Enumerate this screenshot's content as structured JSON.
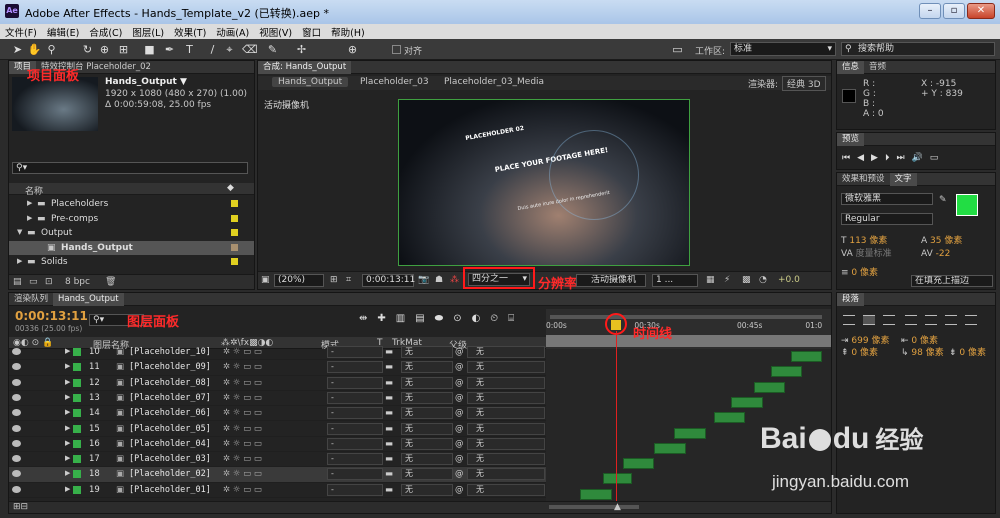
{
  "title": {
    "app": "Adobe After Effects - Hands_Template_v2 (已转换).aep *",
    "logo": "Ae"
  },
  "menu": [
    "文件(F)",
    "编辑(E)",
    "合成(C)",
    "图层(L)",
    "效果(T)",
    "动画(A)",
    "视图(V)",
    "窗口",
    "帮助(H)"
  ],
  "toolbar": {
    "snap_label": "对齐",
    "workspace_label": "工作区:",
    "workspace_value": "标准",
    "search_placeholder": "搜索帮助"
  },
  "project": {
    "tab": "项目",
    "tab2": "特效控制台 Placeholder_02",
    "comp_name": "Hands_Output ▼",
    "resolution": "1920 x 1080  (480 x 270) (1.00)",
    "duration": "Δ 0:00:59:08, 25.00 fps",
    "search_icon": "⚲▾",
    "col_name": "名称",
    "folders": [
      {
        "name": "Placeholders",
        "indent": 1,
        "open": false,
        "color": "#e0d020"
      },
      {
        "name": "Pre-comps",
        "indent": 1,
        "open": false,
        "color": "#e0d020"
      },
      {
        "name": "Output",
        "indent": 0,
        "open": true,
        "color": "#e0d020"
      },
      {
        "name": "Hands_Output",
        "indent": 2,
        "comp": true,
        "color": "#a89070"
      },
      {
        "name": "Solids",
        "indent": 0,
        "open": false,
        "color": "#e0d020"
      }
    ],
    "bpc": "8 bpc",
    "annotation": "项目面板"
  },
  "comp": {
    "tab": "合成: Hands_Output",
    "crumbs": [
      "Hands_Output",
      "Placeholder_03",
      "Placeholder_03_Media"
    ],
    "renderer_label": "渲染器:",
    "renderer_value": "经典 3D",
    "camera_label": "活动摄像机",
    "zoom": "(20%)",
    "timecode": "0:00:13:11",
    "resolution": "四分之一",
    "camera_select": "活动摄像机",
    "views": "1 ...",
    "exposure": "+0.0",
    "annotation": "分辨率",
    "footage": {
      "placeholder": "PLACEHOLDER 02",
      "headline": "PLACE YOUR FOOTAGE HERE!",
      "sub": "Duis aute irure dolor in reprehenderit"
    }
  },
  "info": {
    "tab1": "信息",
    "tab2": "音频",
    "r": "R :",
    "g": "G :",
    "b": "B :",
    "a": "A : 0",
    "x": "X : -915",
    "y": "+ Y : 839"
  },
  "preview": {
    "tab": "预览"
  },
  "char": {
    "tab1": "效果和预设",
    "tab2": "文字",
    "font": "微软雅黑",
    "style": "Regular",
    "size": "113 像素",
    "leading": "35 像素",
    "kerning": "度量标准",
    "tracking": "-22",
    "stroke": "0 像素",
    "stroke_mode": "在填充上描边",
    "fill_color": "#22dd44"
  },
  "para": {
    "tab": "段落",
    "indent_l": "699 像素",
    "indent_r": "0 像素",
    "indent_first": "98 像素",
    "space_before": "0 像素",
    "space_after": "0 像素"
  },
  "timeline": {
    "tab1": "渲染队列",
    "tab2": "Hands_Output",
    "timecode": "0:00:13:11",
    "frames": "00336 (25.00 fps)",
    "search_icon": "⚲▾",
    "annotation_layers": "图层面板",
    "annotation_time": "时间线",
    "col_name": "图层名称",
    "col_mode": "模式",
    "col_t": "T",
    "col_trk": "TrkMat",
    "col_parent": "父级",
    "ruler": [
      "0:00s",
      "00:30s",
      "00:45s",
      "01:0"
    ],
    "layers": [
      {
        "num": "10",
        "name": "[Placeholder_10]",
        "mode": "-",
        "trk": "无",
        "parent": "无",
        "bar_start": 0.86,
        "bar_end": 0.97
      },
      {
        "num": "11",
        "name": "[Placeholder_09]",
        "mode": "-",
        "trk": "无",
        "parent": "无",
        "bar_start": 0.79,
        "bar_end": 0.9
      },
      {
        "num": "12",
        "name": "[Placeholder_08]",
        "mode": "-",
        "trk": "无",
        "parent": "无",
        "bar_start": 0.73,
        "bar_end": 0.84
      },
      {
        "num": "13",
        "name": "[Placeholder_07]",
        "mode": "-",
        "trk": "无",
        "parent": "无",
        "bar_start": 0.65,
        "bar_end": 0.76
      },
      {
        "num": "14",
        "name": "[Placeholder_06]",
        "mode": "-",
        "trk": "无",
        "parent": "无",
        "bar_start": 0.59,
        "bar_end": 0.7
      },
      {
        "num": "15",
        "name": "[Placeholder_05]",
        "mode": "-",
        "trk": "无",
        "parent": "无",
        "bar_start": 0.45,
        "bar_end": 0.56
      },
      {
        "num": "16",
        "name": "[Placeholder_04]",
        "mode": "-",
        "trk": "无",
        "parent": "无",
        "bar_start": 0.38,
        "bar_end": 0.49
      },
      {
        "num": "17",
        "name": "[Placeholder_03]",
        "mode": "-",
        "trk": "无",
        "parent": "无",
        "bar_start": 0.27,
        "bar_end": 0.38
      },
      {
        "num": "18",
        "name": "[Placeholder_02]",
        "mode": "-",
        "trk": "无",
        "parent": "无",
        "bar_start": 0.2,
        "bar_end": 0.3,
        "selected": true
      },
      {
        "num": "19",
        "name": "[Placeholder_01]",
        "mode": "-",
        "trk": "无",
        "parent": "无",
        "bar_start": 0.12,
        "bar_end": 0.23
      }
    ]
  },
  "watermark": {
    "brand": "Bai",
    "brand2": "du",
    "tail": "经验",
    "url": "jingyan.baidu.com"
  }
}
